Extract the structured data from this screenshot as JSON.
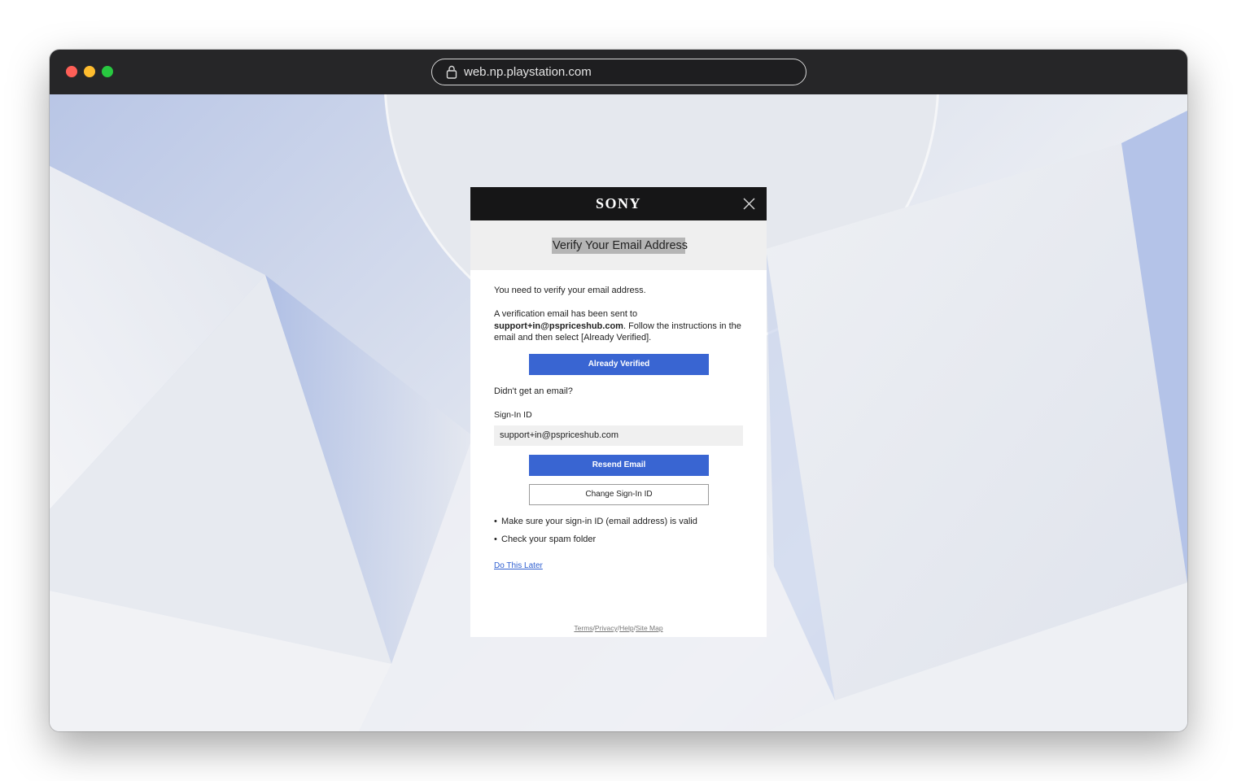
{
  "browser": {
    "url": "web.np.playstation.com"
  },
  "dialog": {
    "brand": "SONY",
    "title": "Verify Your Email Address",
    "intro": "You need to verify your email address.",
    "sent_text_before": "A verification email has been sent to ",
    "email": "support+in@pspriceshub.com",
    "sent_text_after": ". Follow the instructions in the email and then select [Already Verified].",
    "already_verified_button": "Already Verified",
    "no_email_text": "Didn't get an email?",
    "signin_label": "Sign-In ID",
    "signin_value": "support+in@pspriceshub.com",
    "resend_button": "Resend Email",
    "change_button": "Change Sign-In ID",
    "tips": [
      "Make sure your sign-in ID (email address) is valid",
      "Check your spam folder"
    ],
    "later_link": "Do This Later",
    "footer_links": [
      "Terms",
      "Privacy",
      "Help",
      "Site Map"
    ]
  },
  "colors": {
    "primary_button": "#3965d2",
    "header_bg": "#161617",
    "link": "#2f5fd0"
  },
  "icons": [
    "lock-icon",
    "close-icon"
  ]
}
